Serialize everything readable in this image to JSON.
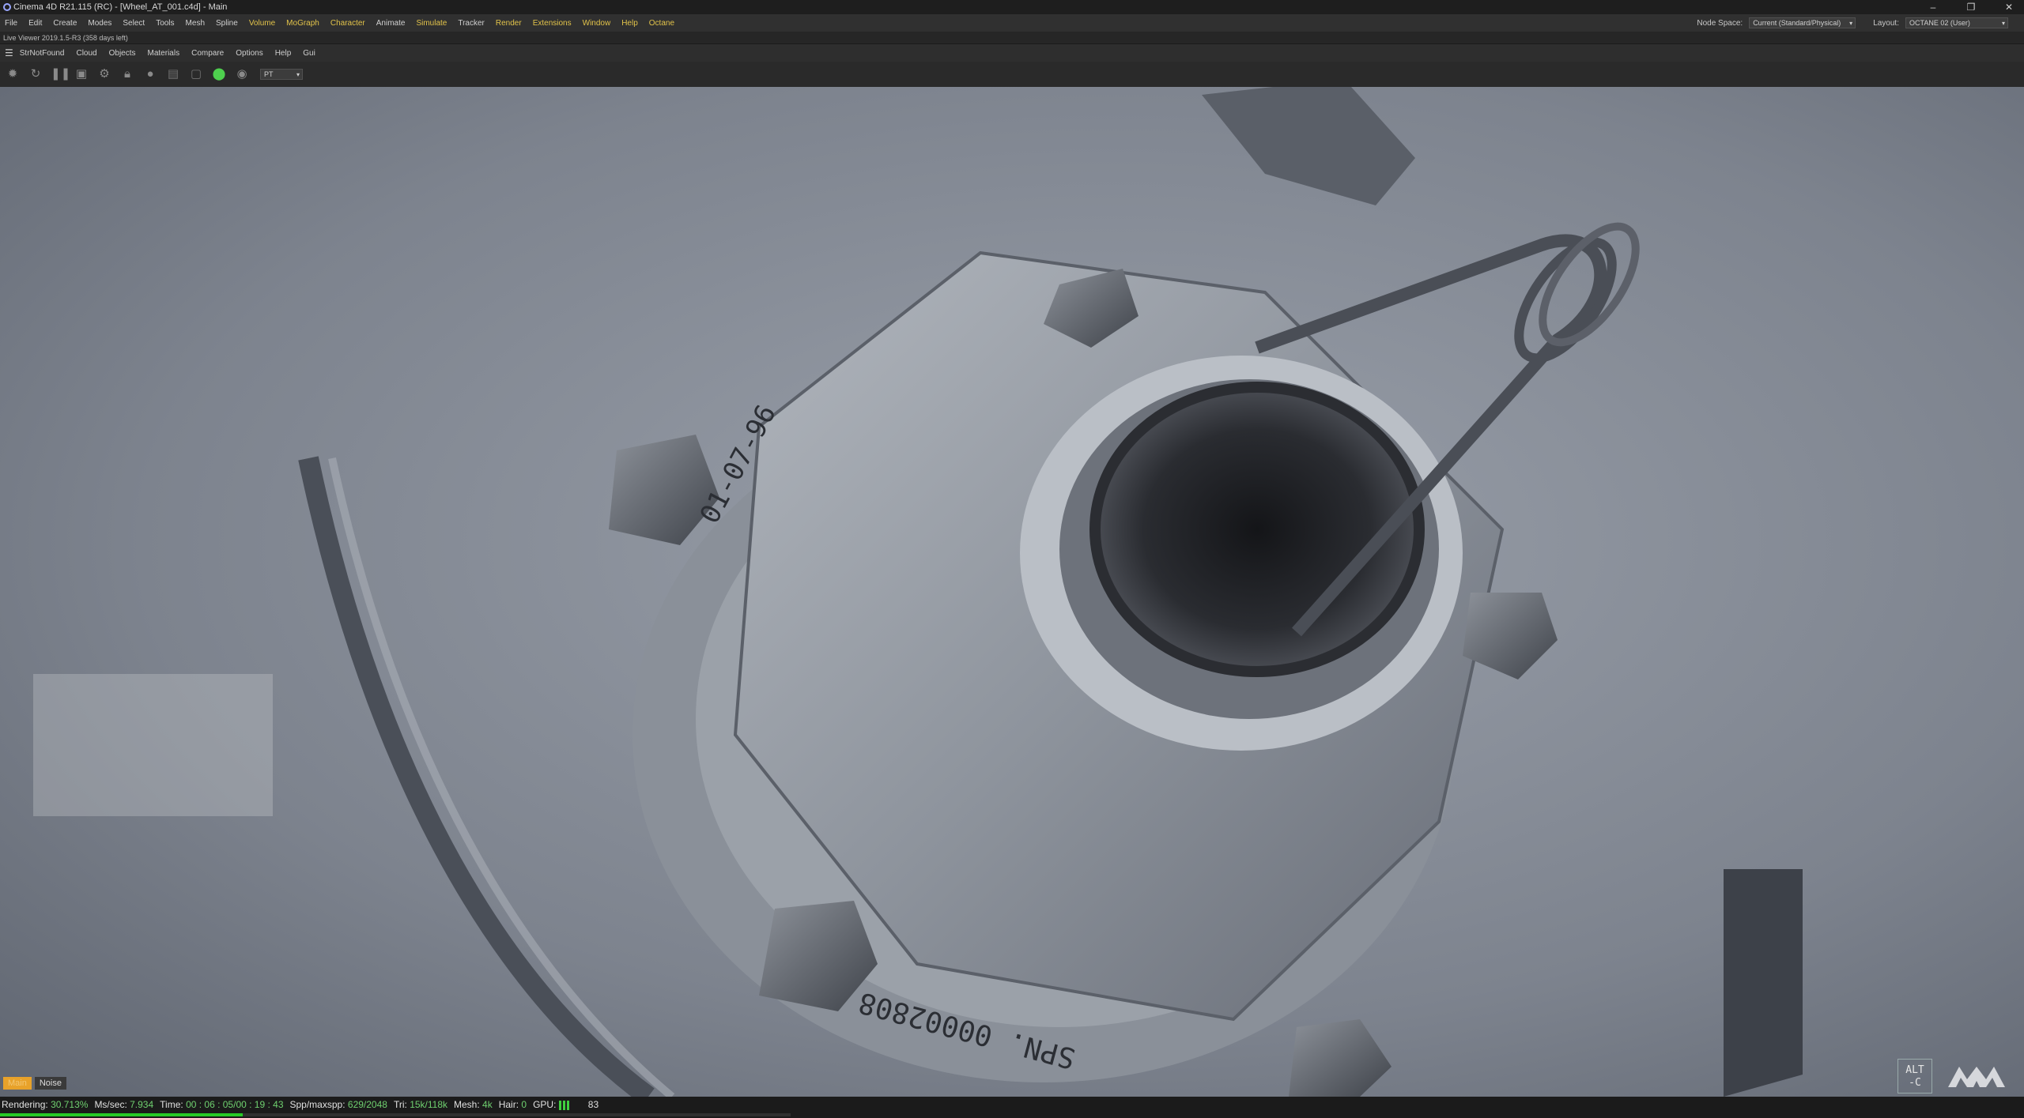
{
  "window": {
    "title": "Cinema 4D R21.115 (RC) - [Wheel_AT_001.c4d] - Main",
    "controls": [
      "–",
      "❐",
      "✕"
    ]
  },
  "menubar": {
    "items": [
      "File",
      "Edit",
      "Create",
      "Modes",
      "Select",
      "Tools",
      "Mesh",
      "Spline",
      "Volume",
      "MoGraph",
      "Character",
      "Animate",
      "Simulate",
      "Tracker",
      "Render",
      "Extensions",
      "Window",
      "Help",
      "Octane"
    ],
    "node_space_label": "Node Space:",
    "node_space_value": "Current (Standard/Physical)",
    "layout_label": "Layout:",
    "layout_value": "OCTANE 02 (User)"
  },
  "live_viewer": {
    "title": "Live Viewer 2019.1.5-R3 (358 days left)",
    "menu": [
      "StrNotFound",
      "Cloud",
      "Objects",
      "Materials",
      "Compare",
      "Options",
      "Help",
      "Gui"
    ],
    "mode_select": "PT",
    "toolbar_icons": [
      "gear-icon",
      "refresh-icon",
      "pause-icon",
      "region-render-icon",
      "settings-cog-icon",
      "lock-icon",
      "sphere-icon",
      "clay-icon",
      "frame-icon",
      "pick-focus-icon",
      "pick-material-icon"
    ]
  },
  "render_mode": {
    "active": "Main",
    "other": "Noise"
  },
  "render_labels": {
    "stamp_top": "01-07-96",
    "stamp_bottom": "SPN. 00002808"
  },
  "status": {
    "rendering_label": "Rendering:",
    "rendering_value": "30.713%",
    "ms_label": "Ms/sec:",
    "ms_value": "7.934",
    "time_label": "Time:",
    "time_value": "00 : 06 : 05/00 : 19 : 43",
    "spp_label": "Spp/maxspp:",
    "spp_value": "629/2048",
    "tri_label": "Tri:",
    "tri_value": "15k/118k",
    "mesh_label": "Mesh:",
    "mesh_value": "4k",
    "hair_label": "Hair:",
    "hair_value": "0",
    "gpu_label": "GPU:",
    "gpu_temp": "83",
    "progress": 0.307
  },
  "badge": {
    "line1": "ALT",
    "line2": "-C"
  },
  "colors": {
    "accent_green": "#27c927",
    "main_chip": "#e8a22a",
    "plugin_menu": "#e2c34a"
  }
}
